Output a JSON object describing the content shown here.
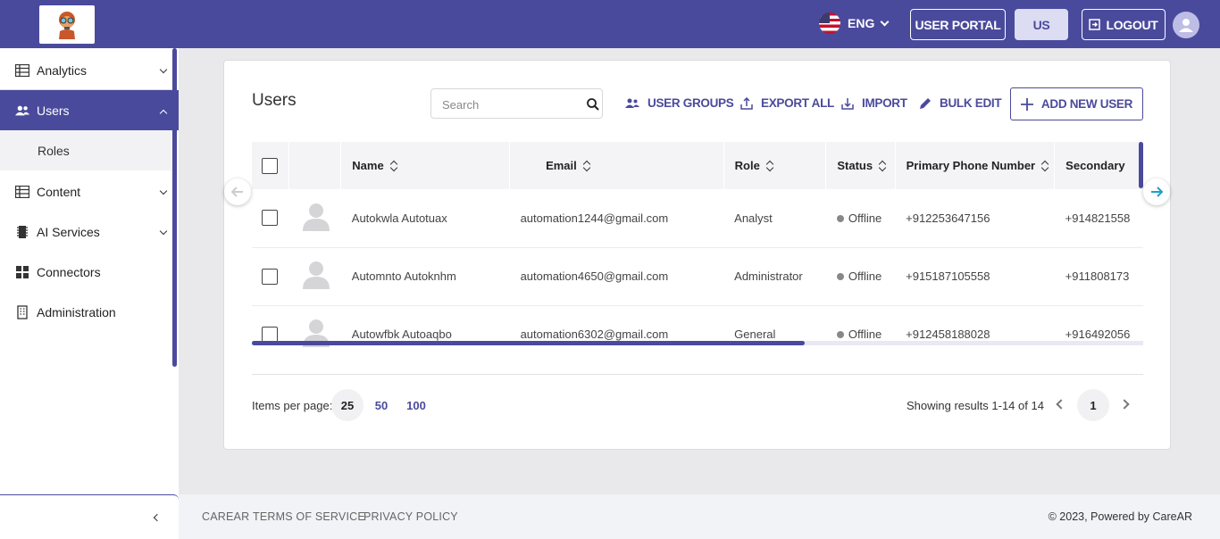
{
  "header": {
    "language": "ENG",
    "user_portal_label": "USER PORTAL",
    "region_label": "US",
    "logout_label": "LOGOUT"
  },
  "sidebar": {
    "items": [
      {
        "label": "Analytics",
        "icon": "table-icon"
      },
      {
        "label": "Users",
        "icon": "users-icon",
        "active": true
      },
      {
        "label": "Roles",
        "icon": ""
      },
      {
        "label": "Content",
        "icon": "table-icon"
      },
      {
        "label": "AI Services",
        "icon": "chip-icon"
      },
      {
        "label": "Connectors",
        "icon": "grid-icon"
      },
      {
        "label": "Administration",
        "icon": "building-icon"
      }
    ]
  },
  "main": {
    "title": "Users",
    "search_placeholder": "Search",
    "actions": {
      "user_groups": "USER GROUPS",
      "export_all": "EXPORT ALL",
      "import": "IMPORT",
      "bulk_edit": "BULK EDIT",
      "add_new_user": "ADD NEW USER"
    },
    "table": {
      "columns": [
        "Name",
        "Email",
        "Role",
        "Status",
        "Primary Phone Number",
        "Secondary"
      ],
      "rows": [
        {
          "name": "Autokwla Autotuax",
          "email": "automation1244@gmail.com",
          "role": "Analyst",
          "status": "Offline",
          "primary_phone": "+912253647156",
          "secondary": "+914821558"
        },
        {
          "name": "Automnto Autoknhm",
          "email": "automation4650@gmail.com",
          "role": "Administrator",
          "status": "Offline",
          "primary_phone": "+915187105558",
          "secondary": "+911808173"
        },
        {
          "name": "Autowfbk Autoaqbo",
          "email": "automation6302@gmail.com",
          "role": "General",
          "status": "Offline",
          "primary_phone": "+912458188028",
          "secondary": "+916492056"
        }
      ]
    },
    "pagination": {
      "items_per_page_label": "Items per page:",
      "page_sizes": [
        "25",
        "50",
        "100"
      ],
      "selected_size": "25",
      "results_text": "Showing results 1-14 of 14",
      "current_page": "1"
    }
  },
  "footer": {
    "links": [
      "CAREAR",
      "TERMS OF SERVICE",
      "PRIVACY POLICY"
    ],
    "copyright": "© 2023, Powered by CareAR"
  },
  "colors": {
    "brand": "#4a4a9c",
    "offline": "#888888"
  }
}
